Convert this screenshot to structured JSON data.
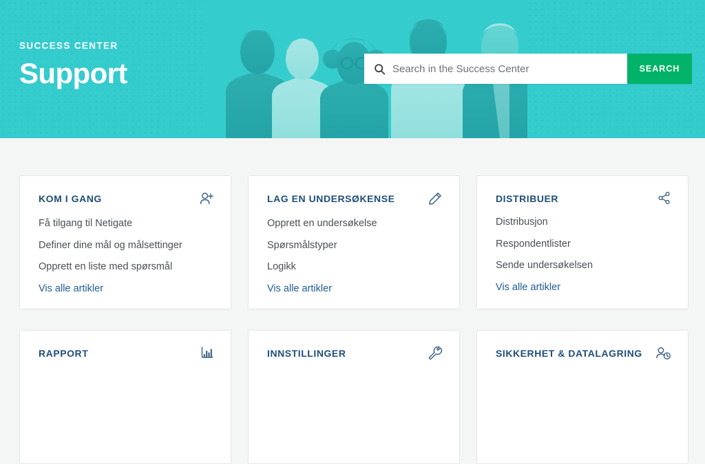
{
  "hero": {
    "kicker": "SUCCESS CENTER",
    "title": "Support",
    "bg_color": "#35ccce"
  },
  "search": {
    "placeholder": "Search in the Success Center",
    "value": "",
    "button_label": "SEARCH",
    "button_color": "#00b368",
    "icon": "search-icon"
  },
  "cards": [
    {
      "title": "KOM I GANG",
      "icon": "user-plus-icon",
      "links": [
        "Få tilgang til Netigate",
        "Definer dine mål og målsettinger",
        "Opprett en liste med spørsmål"
      ],
      "all_label": "Vis alle artikler"
    },
    {
      "title": "LAG EN UNDERSØKENSE",
      "icon": "pencil-icon",
      "links": [
        "Opprett en undersøkelse",
        "Spørsmålstyper",
        "Logikk"
      ],
      "all_label": "Vis alle artikler"
    },
    {
      "title": "DISTRIBUER",
      "icon": "share-icon",
      "links": [
        "Distribusjon",
        "Respondentlister",
        "Sende undersøkelsen"
      ],
      "all_label": "Vis alle artikler"
    },
    {
      "title": "RAPPORT",
      "icon": "bar-chart-icon",
      "links": [],
      "all_label": ""
    },
    {
      "title": "INNSTILLINGER",
      "icon": "wrench-icon",
      "links": [],
      "all_label": ""
    },
    {
      "title": "SIKKERHET & DATALAGRING",
      "icon": "user-clock-icon",
      "links": [],
      "all_label": ""
    }
  ],
  "colors": {
    "page_bg": "#f4f5f5",
    "card_title": "#1f4e79",
    "link": "#4a4f55",
    "link_all": "#1f5c8f"
  }
}
